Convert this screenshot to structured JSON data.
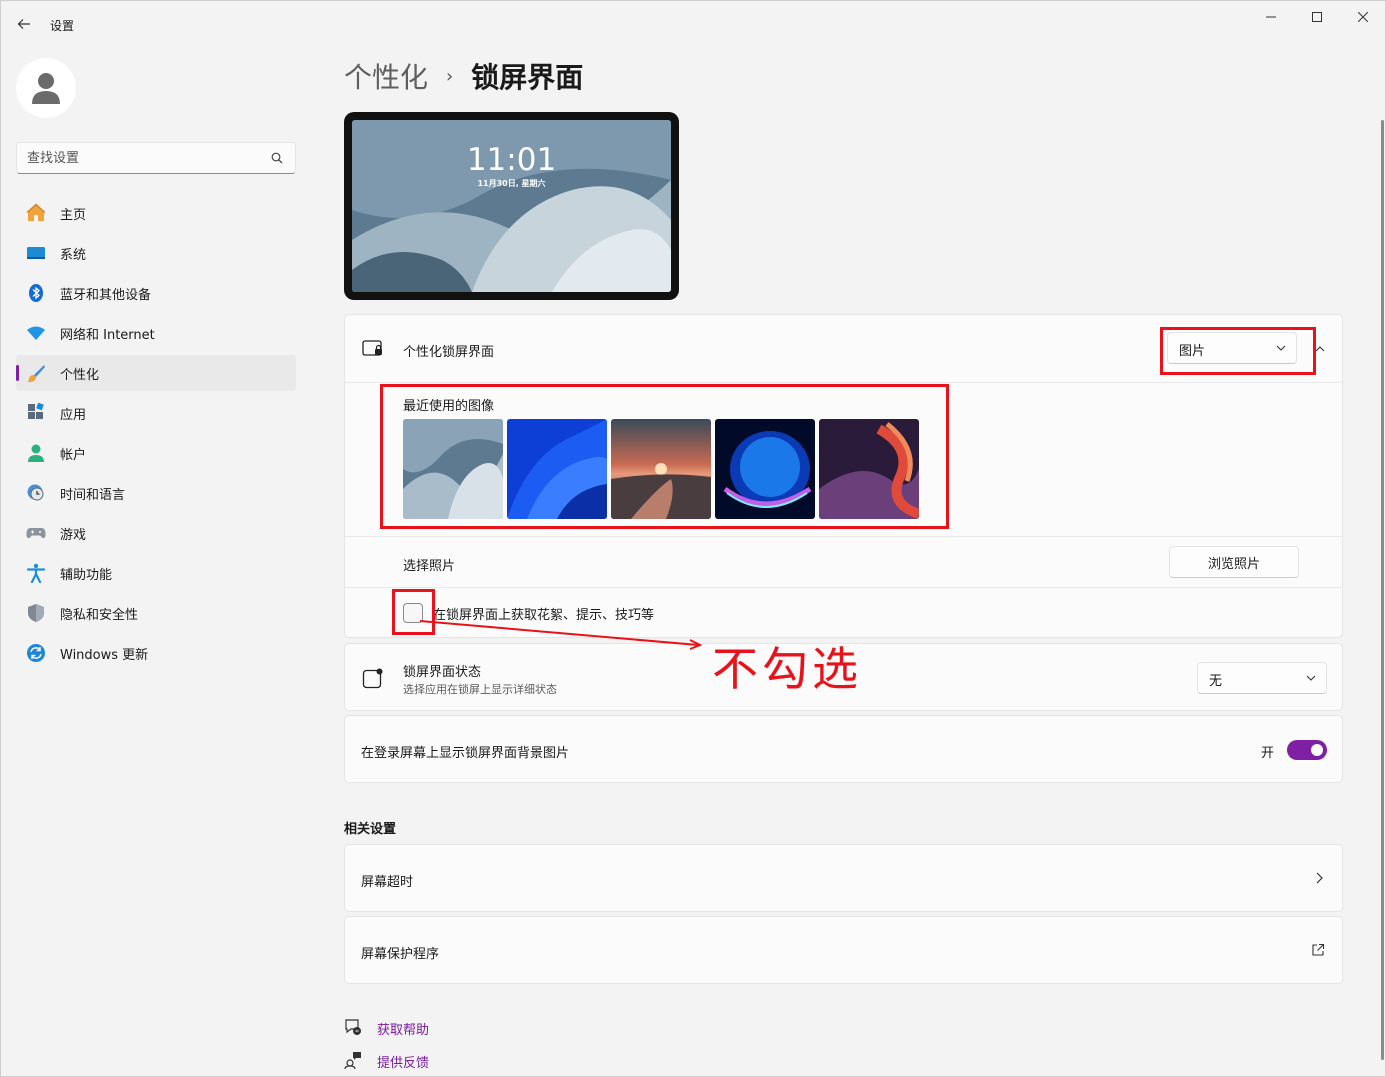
{
  "app": {
    "title": "设置"
  },
  "window_controls": {
    "minimize": "minimize-icon",
    "maximize": "maximize-icon",
    "close": "close-icon"
  },
  "search": {
    "placeholder": "查找设置"
  },
  "sidebar": {
    "items": [
      {
        "label": "主页",
        "icon": "home-icon"
      },
      {
        "label": "系统",
        "icon": "system-icon"
      },
      {
        "label": "蓝牙和其他设备",
        "icon": "bluetooth-icon"
      },
      {
        "label": "网络和 Internet",
        "icon": "wifi-icon"
      },
      {
        "label": "个性化",
        "icon": "personalization-brush-icon",
        "active": true
      },
      {
        "label": "应用",
        "icon": "apps-icon"
      },
      {
        "label": "帐户",
        "icon": "account-icon"
      },
      {
        "label": "时间和语言",
        "icon": "time-language-icon"
      },
      {
        "label": "游戏",
        "icon": "gaming-icon"
      },
      {
        "label": "辅助功能",
        "icon": "accessibility-icon"
      },
      {
        "label": "隐私和安全性",
        "icon": "privacy-shield-icon"
      },
      {
        "label": "Windows 更新",
        "icon": "windows-update-icon"
      }
    ]
  },
  "breadcrumb": {
    "parent": "个性化",
    "separator": "›",
    "current": "锁屏界面"
  },
  "preview": {
    "time": "11:01",
    "date": "11月30日, 星期六"
  },
  "personalize": {
    "title": "个性化锁屏界面",
    "dropdown_value": "图片",
    "recent_title": "最近使用的图像",
    "choose_photo_label": "选择照片",
    "browse_button": "浏览照片",
    "tips_checkbox_label": "在锁屏界面上获取花絮、提示、技巧等",
    "tips_checked": false
  },
  "lock_status": {
    "title": "锁屏界面状态",
    "subtitle": "选择应用在锁屏上显示详细状态",
    "dropdown_value": "无"
  },
  "signin_background": {
    "title": "在登录屏幕上显示锁屏界面背景图片",
    "state_label": "开",
    "on": true
  },
  "related": {
    "title": "相关设置",
    "items": [
      {
        "label": "屏幕超时"
      },
      {
        "label": "屏幕保护程序"
      }
    ]
  },
  "help": {
    "get_help": "获取帮助",
    "feedback": "提供反馈"
  },
  "annotation": {
    "text": "不勾选",
    "color": "#e8121a"
  },
  "colors": {
    "accent": "#7f1fa3",
    "link": "#7a1b9c"
  }
}
